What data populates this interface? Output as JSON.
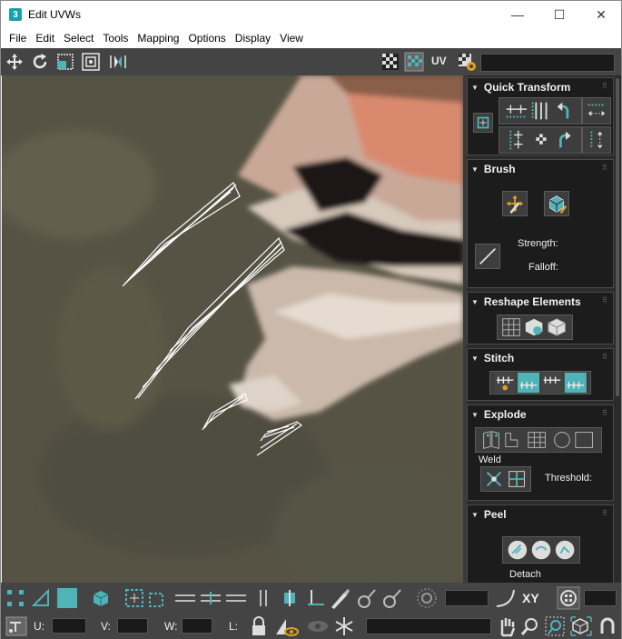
{
  "window": {
    "app_icon_text": "3",
    "title": "Edit UVWs",
    "minimize": "—",
    "maximize": "☐",
    "close": "✕"
  },
  "menu": [
    "File",
    "Edit",
    "Select",
    "Tools",
    "Mapping",
    "Options",
    "Display",
    "View"
  ],
  "toolbar": {
    "uv_label": "UV"
  },
  "panel": {
    "quick_transform": {
      "title": "Quick Transform"
    },
    "brush": {
      "title": "Brush",
      "strength_label": "Strength:",
      "falloff_label": "Falloff:"
    },
    "reshape": {
      "title": "Reshape Elements"
    },
    "stitch": {
      "title": "Stitch"
    },
    "explode": {
      "title": "Explode",
      "weld_label": "Weld",
      "threshold_label": "Threshold:"
    },
    "peel": {
      "title": "Peel",
      "detach_label": "Detach"
    }
  },
  "bottom": {
    "xy_label": "XY",
    "u_label": "U:",
    "v_label": "V:",
    "w_label": "W:",
    "l_label": "L:"
  },
  "colors": {
    "accent_teal": "#4fb3b8",
    "toolbar_bg": "#444444",
    "panel_bg": "#1c1c1c"
  }
}
